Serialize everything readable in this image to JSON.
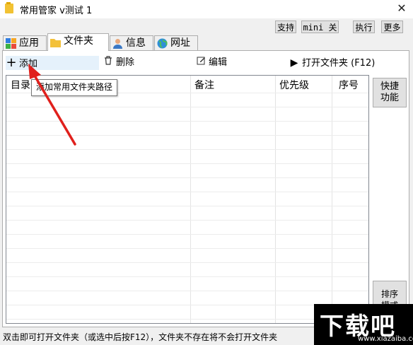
{
  "window": {
    "title": "常用管家 v测试 1",
    "close": "✕"
  },
  "top_buttons": [
    "支持",
    "mini 关",
    "执行",
    "更多"
  ],
  "tabs": [
    {
      "label": "应用",
      "icon": "apps-icon"
    },
    {
      "label": "文件夹",
      "icon": "folder-icon"
    },
    {
      "label": "信息",
      "icon": "user-icon"
    },
    {
      "label": "网址",
      "icon": "globe-icon"
    }
  ],
  "active_tab": "文件夹",
  "toolbar": {
    "add": "添加",
    "delete": "删除",
    "edit": "编辑",
    "open": "打开文件夹 (F12)"
  },
  "tooltip": "添加常用文件夹路径",
  "table": {
    "headers": [
      "目录",
      "备注",
      "优先级",
      "序号"
    ]
  },
  "side_buttons": {
    "quick": [
      "快捷",
      "功能"
    ],
    "sort": [
      "排序",
      "模式"
    ]
  },
  "status_text": "双击即可打开文件夹（或选中后按F12），文件夹不存在将不会打开文件夹",
  "watermark": {
    "text": "下载吧",
    "url": "www.xiazaiba.com"
  }
}
